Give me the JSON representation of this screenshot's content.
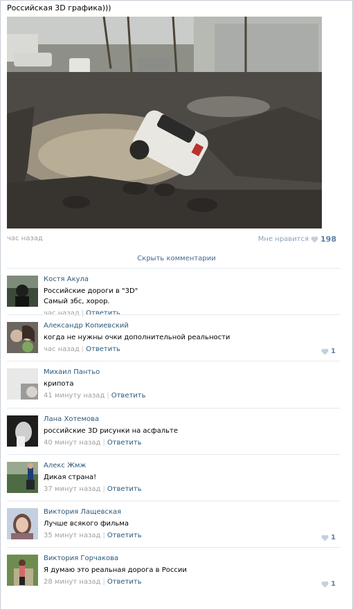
{
  "post": {
    "title": "Российская 3D графика)))",
    "time": "час назад",
    "like_label": "Мне нравится",
    "like_count": "198"
  },
  "hide_comments_label": "Скрыть комментарии",
  "comments": [
    {
      "author": "Костя Акула",
      "lines": [
        "Российские дороги в \"3D\"",
        "Самый збс, хорор."
      ],
      "time": "час назад",
      "reply": "Ответить",
      "likes": ""
    },
    {
      "author": "Александр Копиевский",
      "lines": [
        "когда не нужны очки дополнительной реальности"
      ],
      "time": "час назад",
      "reply": "Ответить",
      "likes": "1"
    },
    {
      "author": "Михаил Пантьо",
      "lines": [
        "крипота"
      ],
      "time": "41 минуту назад",
      "reply": "Ответить",
      "likes": ""
    },
    {
      "author": "Лана Хотемова",
      "lines": [
        "российские 3D рисунки на асфальте"
      ],
      "time": "40 минут назад",
      "reply": "Ответить",
      "likes": ""
    },
    {
      "author": "Алекс Жмж",
      "lines": [
        "Дикая страна!"
      ],
      "time": "37 минут назад",
      "reply": "Ответить",
      "likes": ""
    },
    {
      "author": "Виктория Лащевская",
      "lines": [
        "Лучше всякого фильма"
      ],
      "time": "35 минут назад",
      "reply": "Ответить",
      "likes": "1"
    },
    {
      "author": "Виктория Горчакова",
      "lines": [
        "Я думаю это реальная дорога в России"
      ],
      "time": "28 минут назад",
      "reply": "Ответить",
      "likes": "1"
    }
  ],
  "colors": {
    "link": "#2b587a",
    "muted": "#a0a0a0",
    "like": "#5b7fa6",
    "separator": "#e3e8ee"
  }
}
